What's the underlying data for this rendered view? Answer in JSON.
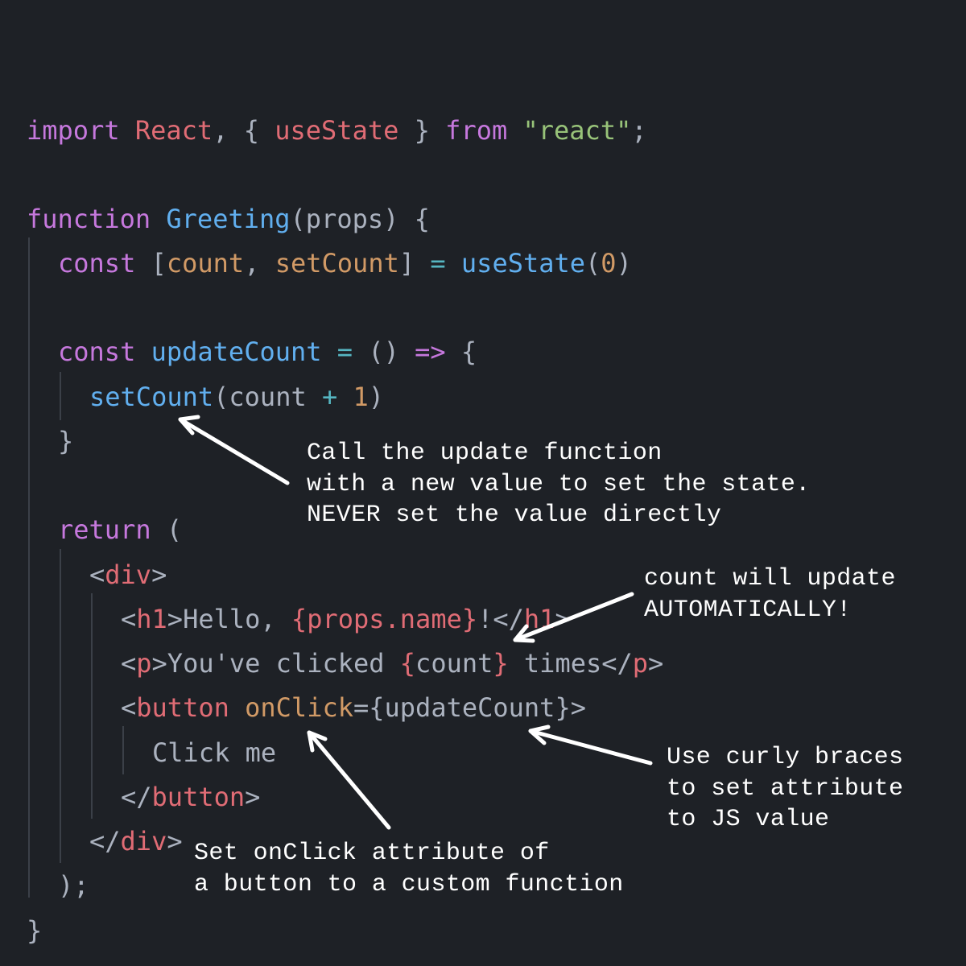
{
  "colors": {
    "background": "#1e2126",
    "keyword": "#c678dd",
    "function": "#61afef",
    "variable": "#e06c75",
    "attribute": "#d19a66",
    "string": "#98c379",
    "punctuation": "#abb2bf",
    "operator": "#56b6c2",
    "annotation": "#ffffff"
  },
  "code": {
    "line_import": [
      {
        "t": "import",
        "c": "k"
      },
      {
        "t": " ",
        "c": "p"
      },
      {
        "t": "React",
        "c": "v"
      },
      {
        "t": ", { ",
        "c": "p"
      },
      {
        "t": "useState",
        "c": "v"
      },
      {
        "t": " } ",
        "c": "p"
      },
      {
        "t": "from",
        "c": "k"
      },
      {
        "t": " ",
        "c": "p"
      },
      {
        "t": "\"react\"",
        "c": "s"
      },
      {
        "t": ";",
        "c": "p"
      }
    ],
    "line_function": [
      {
        "t": "function",
        "c": "k"
      },
      {
        "t": " ",
        "c": "p"
      },
      {
        "t": "Greeting",
        "c": "f"
      },
      {
        "t": "(props) {",
        "c": "p"
      }
    ],
    "line_state": [
      {
        "t": "const",
        "c": "k"
      },
      {
        "t": " [",
        "c": "p"
      },
      {
        "t": "count",
        "c": "a"
      },
      {
        "t": ", ",
        "c": "p"
      },
      {
        "t": "setCount",
        "c": "a"
      },
      {
        "t": "] ",
        "c": "p"
      },
      {
        "t": "=",
        "c": "o"
      },
      {
        "t": " ",
        "c": "p"
      },
      {
        "t": "useState",
        "c": "f"
      },
      {
        "t": "(",
        "c": "p"
      },
      {
        "t": "0",
        "c": "a"
      },
      {
        "t": ")",
        "c": "p"
      }
    ],
    "line_update": [
      {
        "t": "const",
        "c": "k"
      },
      {
        "t": " ",
        "c": "p"
      },
      {
        "t": "updateCount",
        "c": "f"
      },
      {
        "t": " ",
        "c": "p"
      },
      {
        "t": "=",
        "c": "o"
      },
      {
        "t": " () ",
        "c": "p"
      },
      {
        "t": "=>",
        "c": "k"
      },
      {
        "t": " {",
        "c": "p"
      }
    ],
    "line_setcount": [
      {
        "t": "setCount",
        "c": "f"
      },
      {
        "t": "(count ",
        "c": "p"
      },
      {
        "t": "+",
        "c": "o"
      },
      {
        "t": " ",
        "c": "p"
      },
      {
        "t": "1",
        "c": "a"
      },
      {
        "t": ")",
        "c": "p"
      }
    ],
    "line_close_brace": [
      {
        "t": "}",
        "c": "p"
      }
    ],
    "line_return": [
      {
        "t": "return",
        "c": "k"
      },
      {
        "t": " (",
        "c": "p"
      }
    ],
    "line_div_open": [
      {
        "t": "<",
        "c": "p"
      },
      {
        "t": "div",
        "c": "v"
      },
      {
        "t": ">",
        "c": "p"
      }
    ],
    "line_h1": [
      {
        "t": "<",
        "c": "p"
      },
      {
        "t": "h1",
        "c": "v"
      },
      {
        "t": ">Hello, ",
        "c": "t"
      },
      {
        "t": "{props.name}",
        "c": "v"
      },
      {
        "t": "!</",
        "c": "t"
      },
      {
        "t": "h1",
        "c": "v"
      },
      {
        "t": ">",
        "c": "p"
      }
    ],
    "line_p": [
      {
        "t": "<",
        "c": "p"
      },
      {
        "t": "p",
        "c": "v"
      },
      {
        "t": ">You've clicked ",
        "c": "t"
      },
      {
        "t": "{",
        "c": "v"
      },
      {
        "t": "count",
        "c": "t"
      },
      {
        "t": "}",
        "c": "v"
      },
      {
        "t": " times</",
        "c": "t"
      },
      {
        "t": "p",
        "c": "v"
      },
      {
        "t": ">",
        "c": "p"
      }
    ],
    "line_button_open": [
      {
        "t": "<",
        "c": "p"
      },
      {
        "t": "button",
        "c": "v"
      },
      {
        "t": " ",
        "c": "p"
      },
      {
        "t": "onClick",
        "c": "a"
      },
      {
        "t": "={updateCount}>",
        "c": "p"
      }
    ],
    "line_button_text": [
      {
        "t": "Click me",
        "c": "t"
      }
    ],
    "line_button_close": [
      {
        "t": "</",
        "c": "p"
      },
      {
        "t": "button",
        "c": "v"
      },
      {
        "t": ">",
        "c": "p"
      }
    ],
    "line_div_close": [
      {
        "t": "</",
        "c": "p"
      },
      {
        "t": "div",
        "c": "v"
      },
      {
        "t": ">",
        "c": "p"
      }
    ],
    "line_paren_close": [
      {
        "t": ");",
        "c": "p"
      }
    ],
    "line_final_brace": [
      {
        "t": "}",
        "c": "p"
      }
    ]
  },
  "annotations": {
    "update_function": "Call the update function\nwith a new value to set the state.\nNEVER set the value directly",
    "auto_update": "count will update\nAUTOMATICALLY!",
    "curly_braces": "Use curly braces\nto set attribute\nto JS value",
    "onclick": "Set onClick attribute of\na button to a custom function"
  }
}
